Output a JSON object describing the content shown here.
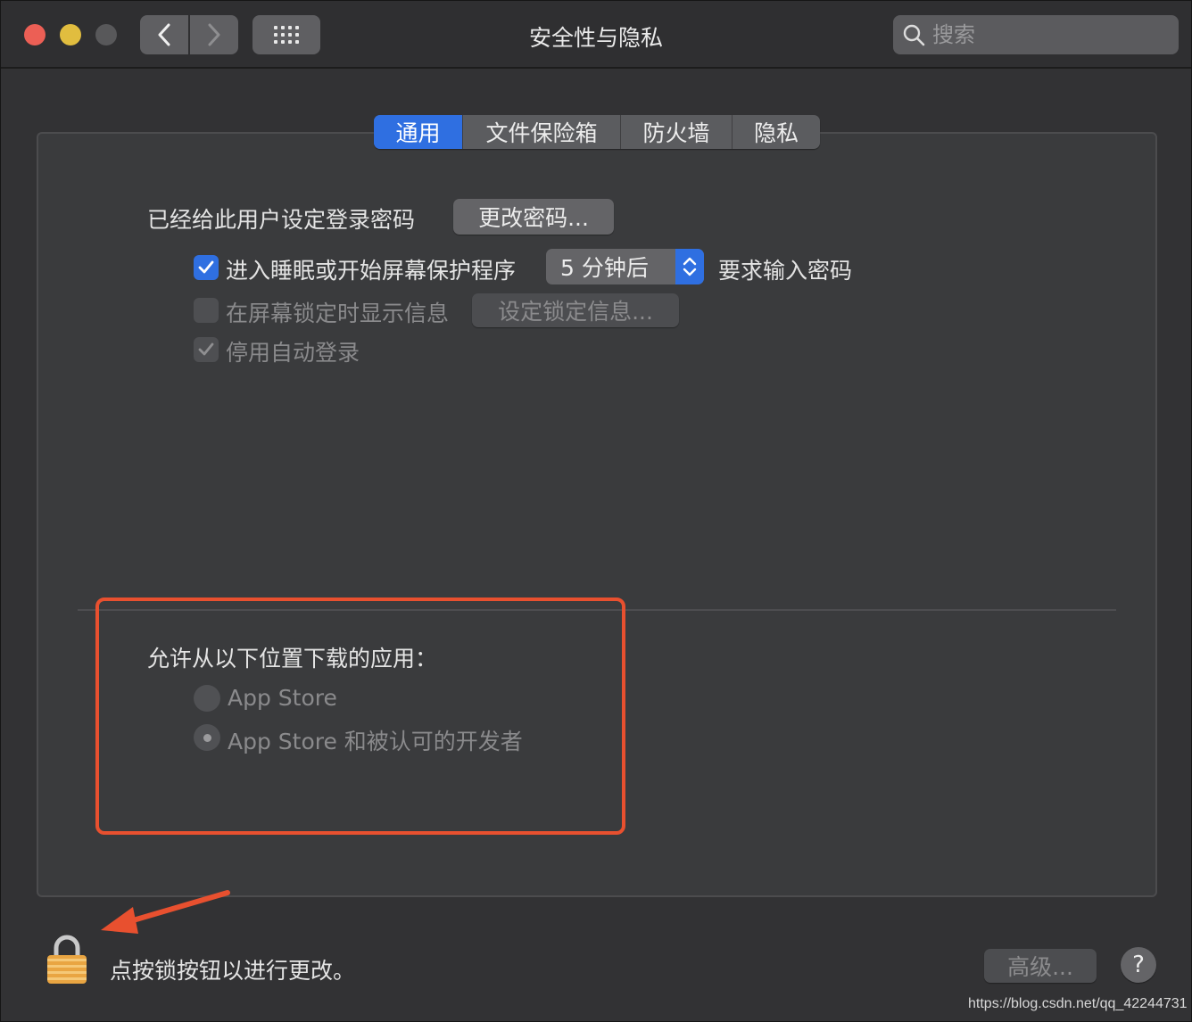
{
  "window": {
    "title": "安全性与隐私"
  },
  "search": {
    "placeholder": "搜索"
  },
  "tabs": [
    {
      "label": "通用",
      "active": true
    },
    {
      "label": "文件保险箱",
      "active": false
    },
    {
      "label": "防火墙",
      "active": false
    },
    {
      "label": "隐私",
      "active": false
    }
  ],
  "general": {
    "password_set_label": "已经给此用户设定登录密码",
    "change_password_button": "更改密码...",
    "require_password": {
      "checked": true,
      "label": "进入睡眠或开始屏幕保护程序",
      "delay_value": "5 分钟后",
      "suffix": "要求输入密码"
    },
    "show_message": {
      "checked": false,
      "label": "在屏幕锁定时显示信息",
      "button": "设定锁定信息..."
    },
    "disable_auto_login": {
      "checked": true,
      "label": "停用自动登录"
    }
  },
  "downloads": {
    "heading": "允许从以下位置下载的应用：",
    "options": [
      {
        "label": "App Store",
        "selected": false
      },
      {
        "label": "App Store 和被认可的开发者",
        "selected": true
      }
    ]
  },
  "footer": {
    "lock_text": "点按锁按钮以进行更改。",
    "advanced_button": "高级...",
    "help_button": "?"
  },
  "watermark": "https://blog.csdn.net/qq_42244731",
  "colors": {
    "accent": "#2f6fe1",
    "highlight": "#e8502f",
    "close": "#ec5f55",
    "minimize": "#e1bd3f"
  }
}
